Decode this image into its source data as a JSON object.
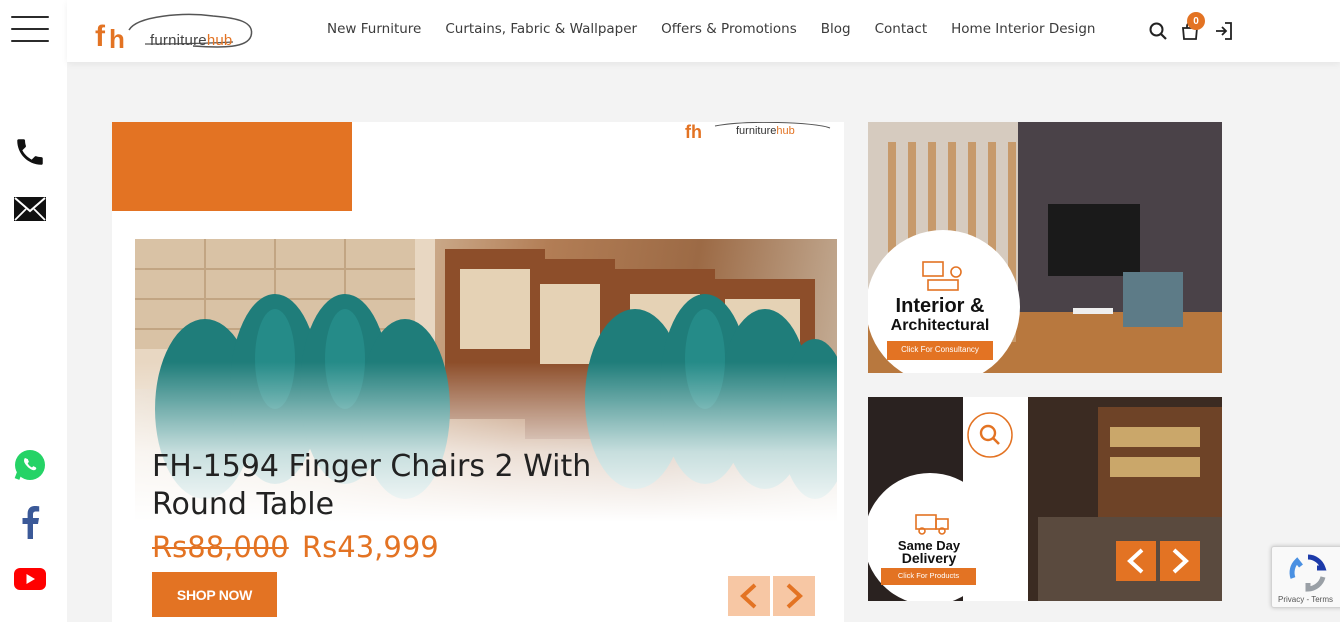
{
  "brand": {
    "logo_mark": "fh",
    "logo_name_prefix": "furniture",
    "logo_name_suffix": "hub",
    "accent_color": "#e37323"
  },
  "nav": {
    "items": [
      {
        "label": "New Furniture"
      },
      {
        "label": "Curtains, Fabric & Wallpaper"
      },
      {
        "label": "Offers & Promotions"
      },
      {
        "label": "Blog"
      },
      {
        "label": "Contact"
      },
      {
        "label": "Home Interior Design"
      }
    ]
  },
  "header_icons": {
    "search": "search-icon",
    "cart": "shopping-bag-icon",
    "cart_count": "0",
    "login": "login-icon"
  },
  "rail": {
    "menu": "hamburger-icon",
    "icons": [
      "phone-icon",
      "mail-icon",
      "whatsapp-icon",
      "facebook-icon",
      "youtube-icon"
    ]
  },
  "slide": {
    "title": "FH-1594 Finger Chairs 2 With Round Table",
    "price_old": "Rs88,000",
    "price_new": "Rs43,999",
    "cta": "SHOP NOW"
  },
  "banner1": {
    "heading_line1": "Interior &",
    "heading_line2": "Architectural",
    "cta": "Click For Consultancy"
  },
  "banner2": {
    "heading_line1": "Same Day",
    "heading_line2": "Delivery",
    "cta": "Click For Products"
  },
  "recaptcha": {
    "privacy": "Privacy",
    "separator": " - ",
    "terms": "Terms"
  }
}
